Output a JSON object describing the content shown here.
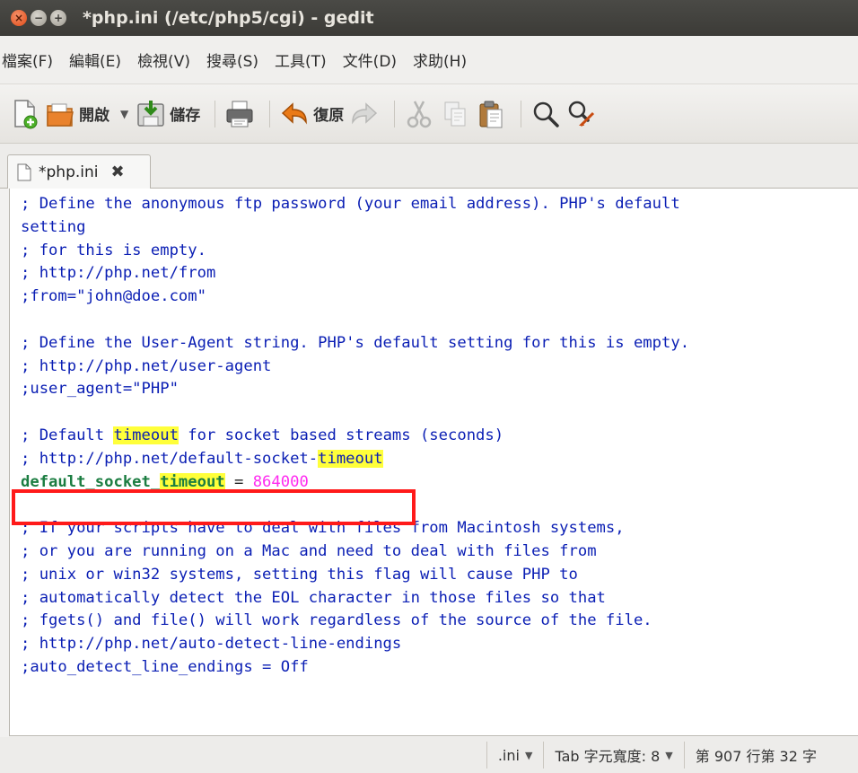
{
  "window": {
    "title": "*php.ini (/etc/php5/cgi) - gedit"
  },
  "menu": {
    "items": [
      "檔案(F)",
      "編輯(E)",
      "檢視(V)",
      "搜尋(S)",
      "工具(T)",
      "文件(D)",
      "求助(H)"
    ]
  },
  "toolbar": {
    "open_label": "開啟",
    "save_label": "儲存",
    "undo_label": "復原"
  },
  "tab": {
    "label": "*php.ini"
  },
  "editor": {
    "lines": [
      {
        "text": "; Define the anonymous ftp password (your email address). PHP's default",
        "style": "cmt"
      },
      {
        "text": "setting",
        "style": "cmt"
      },
      {
        "text": "; for this is empty.",
        "style": "cmt"
      },
      {
        "text": "; http://php.net/from",
        "style": "cmt"
      },
      {
        "text": ";from=\"john@doe.com\"",
        "style": "cmt"
      },
      {
        "text": "",
        "style": "cmt"
      },
      {
        "text": "; Define the User-Agent string. PHP's default setting for this is empty.",
        "style": "cmt"
      },
      {
        "text": "; http://php.net/user-agent",
        "style": "cmt"
      },
      {
        "text": ";user_agent=\"PHP\"",
        "style": "cmt"
      },
      {
        "text": "",
        "style": "cmt"
      },
      {
        "segments": [
          {
            "text": "; Default ",
            "style": "cmt"
          },
          {
            "text": "timeout",
            "style": "cmt hl"
          },
          {
            "text": " for socket based streams (seconds)",
            "style": "cmt"
          }
        ]
      },
      {
        "segments": [
          {
            "text": "; http://php.net/default-socket-",
            "style": "cmt"
          },
          {
            "text": "timeout",
            "style": "cmt hl"
          }
        ]
      },
      {
        "segments": [
          {
            "text": "default_socket_",
            "style": "kw"
          },
          {
            "text": "timeout",
            "style": "kw hl"
          },
          {
            "text": " = ",
            "style": "plain"
          },
          {
            "text": "864000",
            "style": "num"
          }
        ]
      },
      {
        "text": "",
        "style": "cmt"
      },
      {
        "text": "; If your scripts have to deal with files from Macintosh systems,",
        "style": "cmt"
      },
      {
        "text": "; or you are running on a Mac and need to deal with files from",
        "style": "cmt"
      },
      {
        "text": "; unix or win32 systems, setting this flag will cause PHP to",
        "style": "cmt"
      },
      {
        "text": "; automatically detect the EOL character in those files so that",
        "style": "cmt"
      },
      {
        "text": "; fgets() and file() will work regardless of the source of the file.",
        "style": "cmt"
      },
      {
        "text": "; http://php.net/auto-detect-line-endings",
        "style": "cmt"
      },
      {
        "text": ";auto_detect_line_endings = Off",
        "style": "cmt"
      }
    ]
  },
  "status": {
    "language": ".ini",
    "tab_width": "Tab 字元寬度: 8",
    "position": "第 907 行第 32 字"
  }
}
